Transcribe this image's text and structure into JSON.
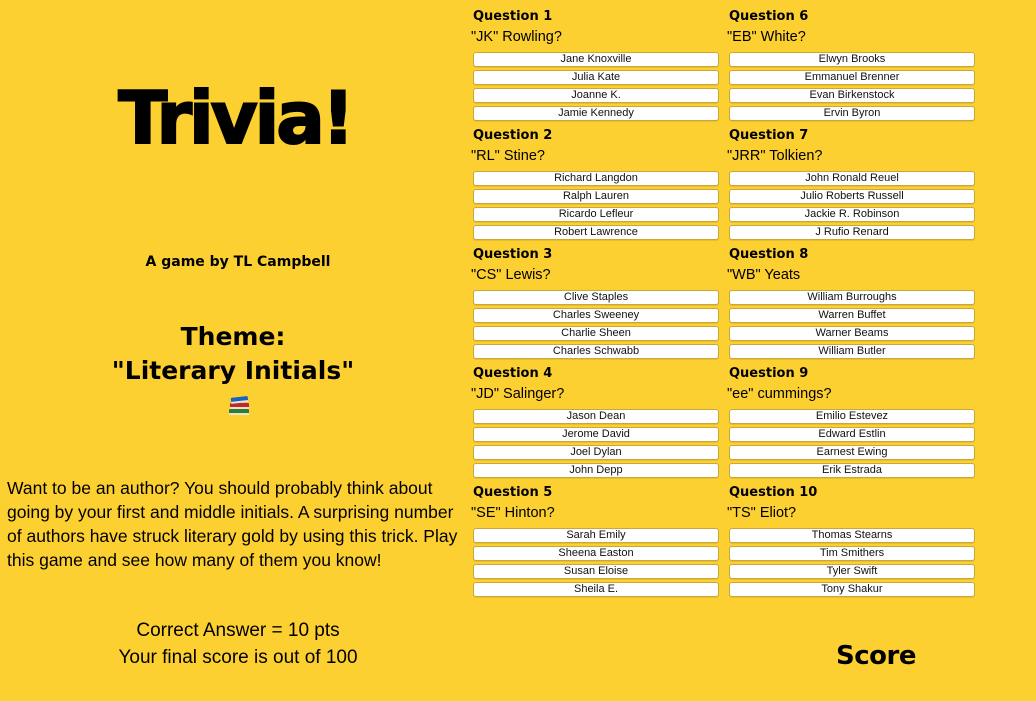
{
  "header": {
    "title": "Trivia!",
    "byline": "A game by TL Campbell",
    "theme_line1": "Theme:",
    "theme_line2": "\"Literary Initials\"",
    "theme_icon": "books-icon"
  },
  "intro": {
    "text": "Want to be an author? You should probably think about going by your first and middle initials. A surprising number of authors have struck literary gold by using this trick. Play this game and see how many of them you know!",
    "scoring_line1": "Correct Answer = 10 pts",
    "scoring_line2": "Your final score is out of 100"
  },
  "questions": [
    {
      "label": "Question 1",
      "prompt": "\"JK\" Rowling?",
      "options": [
        "Jane Knoxville",
        "Julia Kate",
        "Joanne K.",
        "Jamie Kennedy"
      ]
    },
    {
      "label": "Question 2",
      "prompt": "\"RL\" Stine?",
      "options": [
        "Richard Langdon",
        "Ralph Lauren",
        "Ricardo Lefleur",
        "Robert Lawrence"
      ]
    },
    {
      "label": "Question 3",
      "prompt": "\"CS\" Lewis?",
      "options": [
        "Clive Staples",
        "Charles Sweeney",
        "Charlie Sheen",
        "Charles Schwabb"
      ]
    },
    {
      "label": "Question 4",
      "prompt": "\"JD\" Salinger?",
      "options": [
        "Jason Dean",
        "Jerome David",
        "Joel Dylan",
        "John Depp"
      ]
    },
    {
      "label": "Question 5",
      "prompt": "\"SE\" Hinton?",
      "options": [
        "Sarah Emily",
        "Sheena Easton",
        "Susan Eloise",
        "Sheila E."
      ]
    },
    {
      "label": "Question 6",
      "prompt": "\"EB\" White?",
      "options": [
        "Elwyn Brooks",
        "Emmanuel Brenner",
        "Evan Birkenstock",
        "Ervin Byron"
      ]
    },
    {
      "label": "Question 7",
      "prompt": "\"JRR\" Tolkien?",
      "options": [
        "John Ronald Reuel",
        "Julio Roberts Russell",
        "Jackie R. Robinson",
        "J Rufio Renard"
      ]
    },
    {
      "label": "Question 8",
      "prompt": "\"WB\" Yeats",
      "options": [
        "William Burroughs",
        "Warren Buffet",
        "Warner Beams",
        "William Butler"
      ]
    },
    {
      "label": "Question 9",
      "prompt": "\"ee\" cummings?",
      "options": [
        "Emilio Estevez",
        "Edward Estlin",
        "Earnest Ewing",
        "Erik Estrada"
      ]
    },
    {
      "label": "Question 10",
      "prompt": "\"TS\" Eliot?",
      "options": [
        "Thomas Stearns",
        "Tim Smithers",
        "Tyler Swift",
        "Tony Shakur"
      ]
    }
  ],
  "score": {
    "label": "Score"
  },
  "colors": {
    "background": "#FDD032",
    "option_background": "#FFFFFF",
    "option_border": "#C9A73A"
  }
}
